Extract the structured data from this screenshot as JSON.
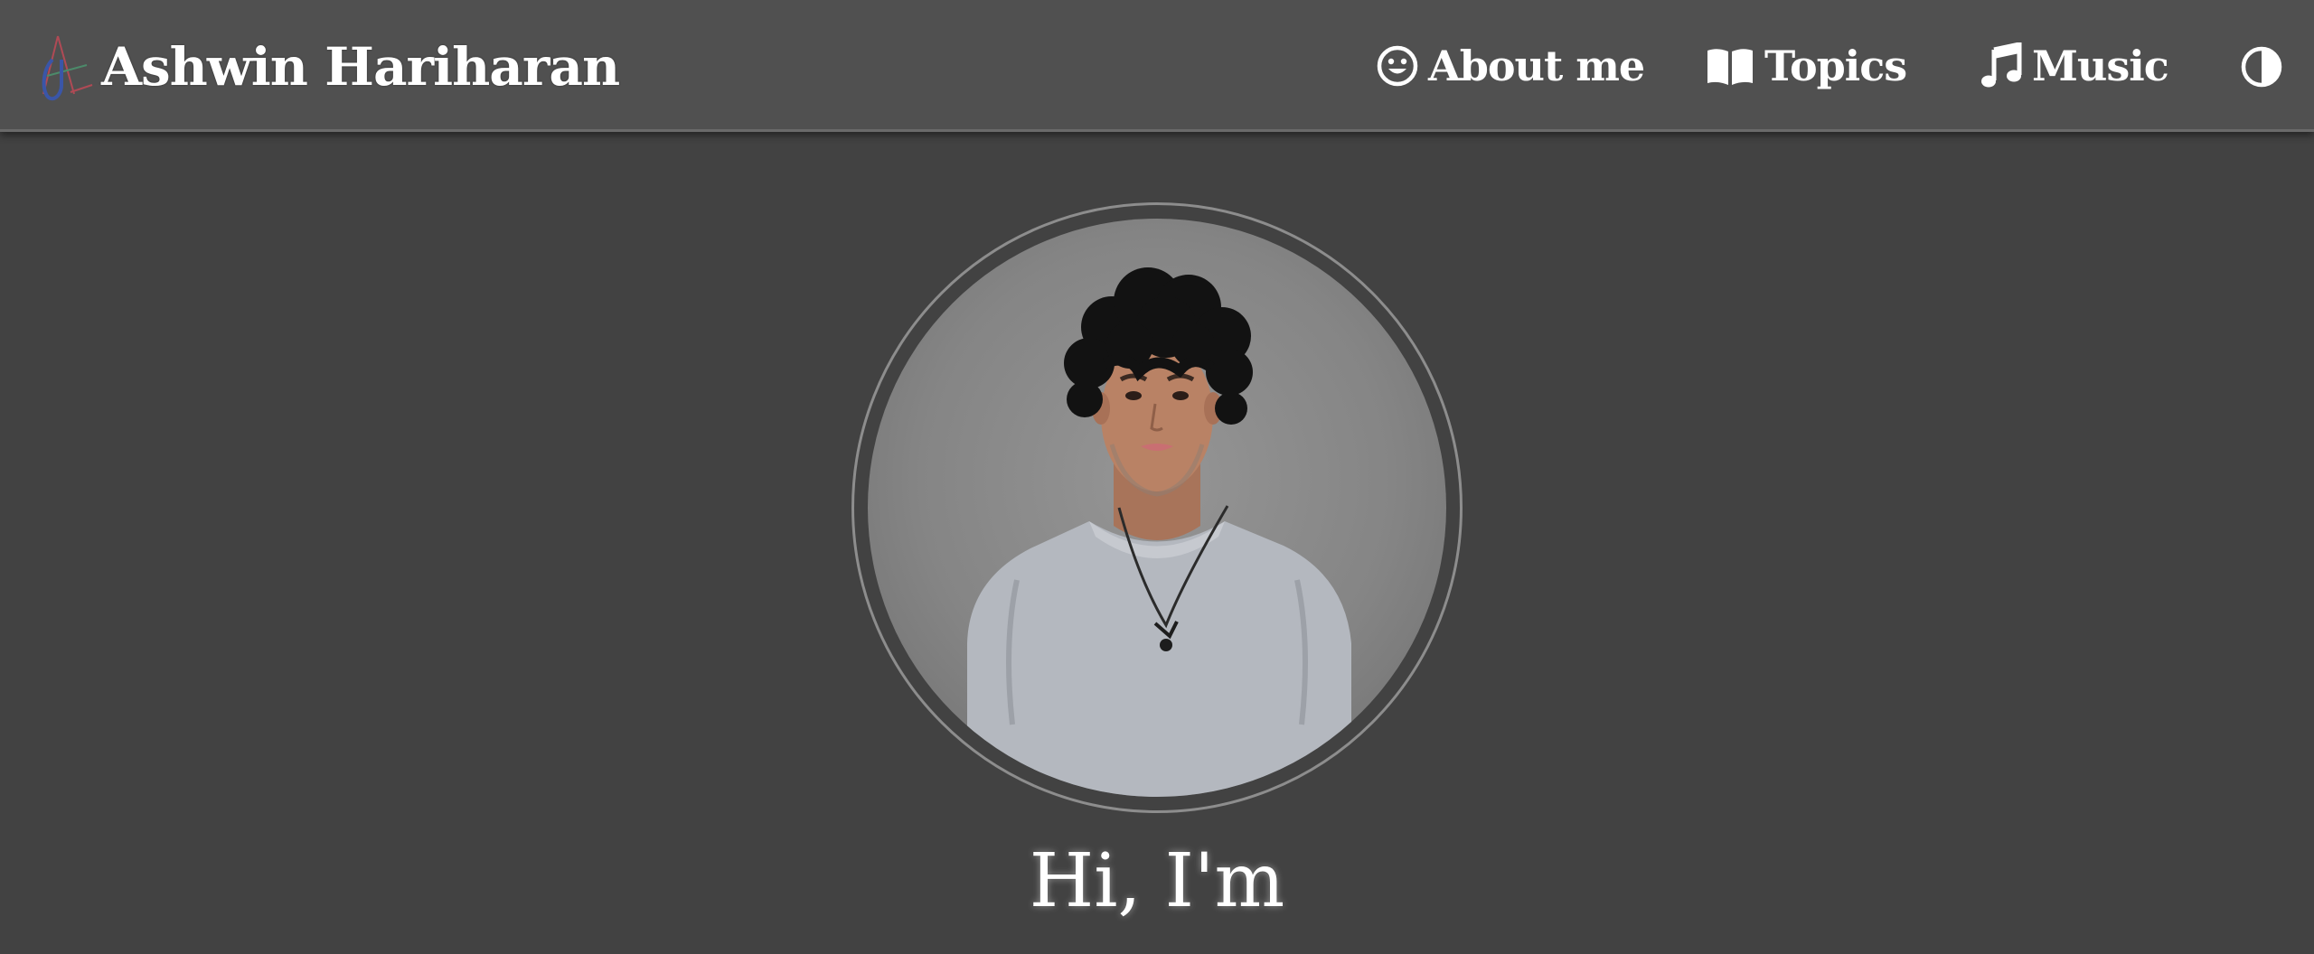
{
  "header": {
    "site_name": "Ashwin Hariharan",
    "logo_icon": "ah-monogram-logo",
    "nav": [
      {
        "label": "About me",
        "icon": "smiley-face-icon"
      },
      {
        "label": "Topics",
        "icon": "open-book-icon"
      },
      {
        "label": "Music",
        "icon": "music-note-icon"
      }
    ],
    "theme_toggle_icon": "contrast-half-circle-icon"
  },
  "hero": {
    "greeting": "Hi, I'm"
  },
  "colors": {
    "page_background": "#424242",
    "navbar_background": "#505050",
    "text": "#ffffff",
    "avatar_ring": "#8d8d8d",
    "shirt": "#b4b8bf"
  }
}
